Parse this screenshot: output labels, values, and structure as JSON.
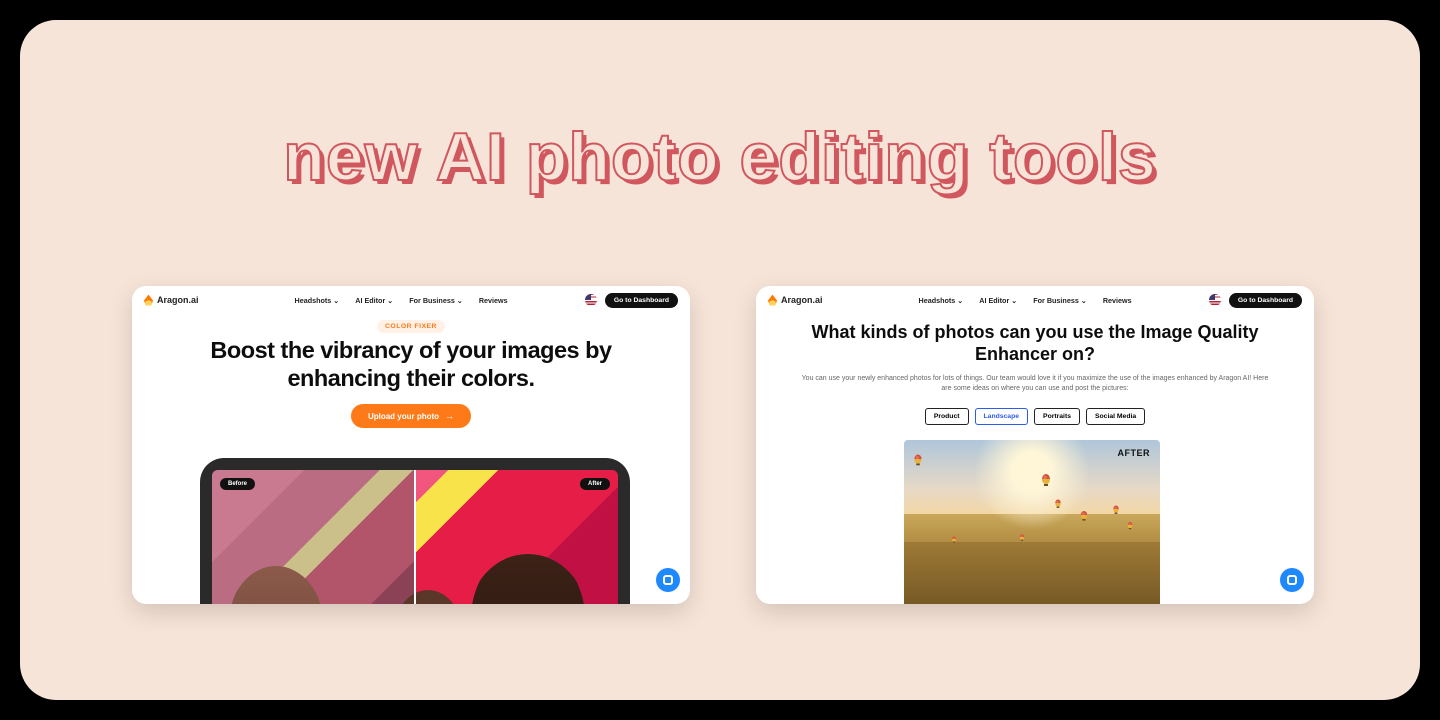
{
  "headline": "new AI photo editing tools",
  "nav": {
    "brand": "Aragon.ai",
    "items": [
      "Headshots",
      "AI Editor",
      "For Business",
      "Reviews"
    ],
    "dashboard": "Go to Dashboard"
  },
  "left": {
    "tag": "COLOR FIXER",
    "title_l1": "Boost the vibrancy of your images by",
    "title_l2": "enhancing their colors.",
    "cta": "Upload your photo",
    "before": "Before",
    "after": "After"
  },
  "right": {
    "title_l1": "What kinds of photos can you use the Image Quality",
    "title_l2": "Enhancer on?",
    "sub": "You can use your newly enhanced photos for lots of things. Our team would love it if you maximize the use of the images enhanced by Aragon AI! Here are some ideas on where you can use and post the pictures:",
    "chips": [
      "Product",
      "Landscape",
      "Portraits",
      "Social Media"
    ],
    "active_chip": "Landscape",
    "after_label": "AFTER"
  }
}
